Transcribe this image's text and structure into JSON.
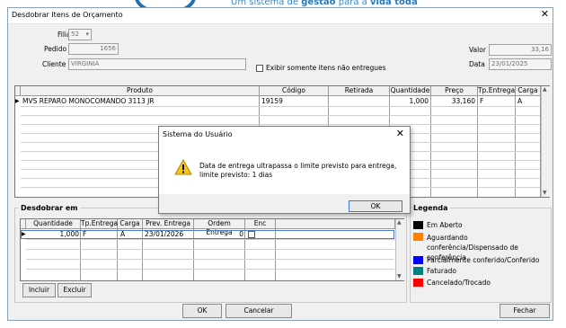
{
  "banner": {
    "text_prefix": "Um sistema de ",
    "text_bold1": "gestão",
    "text_mid": " para a ",
    "text_bold2": "vida toda"
  },
  "window": {
    "title": "Desdobrar Itens de Orçamento",
    "close_glyph": "✕"
  },
  "form": {
    "filial_label": "Filial",
    "filial_value": "52",
    "pedido_label": "Pedido",
    "pedido_value": "1656",
    "cliente_label": "Cliente",
    "cliente_value": "VIRGINIA",
    "exibir_label": "Exibir somente itens não entregues",
    "valor_label": "Valor",
    "valor_value": "33,16",
    "data_label": "Data",
    "data_value": "23/01/2025"
  },
  "items_table": {
    "columns": [
      "Produto",
      "Código",
      "Retirada",
      "Quantidade",
      "Preço",
      "Tp.Entrega",
      "Carga"
    ],
    "rows": [
      {
        "produto": "MVS REPARO MONOCOMANDO 3113 JR",
        "codigo": "19159",
        "retirada": "",
        "quantidade": "1,000",
        "preco": "33,160",
        "tp_entrega": "F",
        "carga": "A"
      }
    ]
  },
  "desdobrar": {
    "title": "Desdobrar em",
    "columns": [
      "Quantidade",
      "Tp.Entrega",
      "Carga",
      "Prev. Entrega",
      "Ordem Entrega",
      "Enc"
    ],
    "rows": [
      {
        "quantidade": "1,000",
        "tp_entrega": "F",
        "carga": "A",
        "prev_entrega": "23/01/2026",
        "ordem_entrega": "0"
      }
    ],
    "incluir_label": "Incluir",
    "excluir_label": "Excluir"
  },
  "legend": {
    "title": "Legenda",
    "items": [
      {
        "label": "Em Aberto",
        "color": "#000000"
      },
      {
        "label": "Aguardando conferência/Dispensado de conferência",
        "color": "#ff8000"
      },
      {
        "label": "Parcialmente conferido/Conferido",
        "color": "#0000ff"
      },
      {
        "label": "Faturado",
        "color": "#008080"
      },
      {
        "label": "Cancelado/Trocado",
        "color": "#ff0000"
      }
    ]
  },
  "buttons": {
    "ok": "OK",
    "cancelar": "Cancelar",
    "fechar": "Fechar"
  },
  "dialog": {
    "title": "Sistema do Usuário",
    "close_glyph": "✕",
    "message_line1": "Data de entrega ultrapassa o limite previsto para entrega,",
    "message_line2": "limite previsto: 1 dias",
    "ok_label": "OK",
    "icon": "warning-icon"
  }
}
